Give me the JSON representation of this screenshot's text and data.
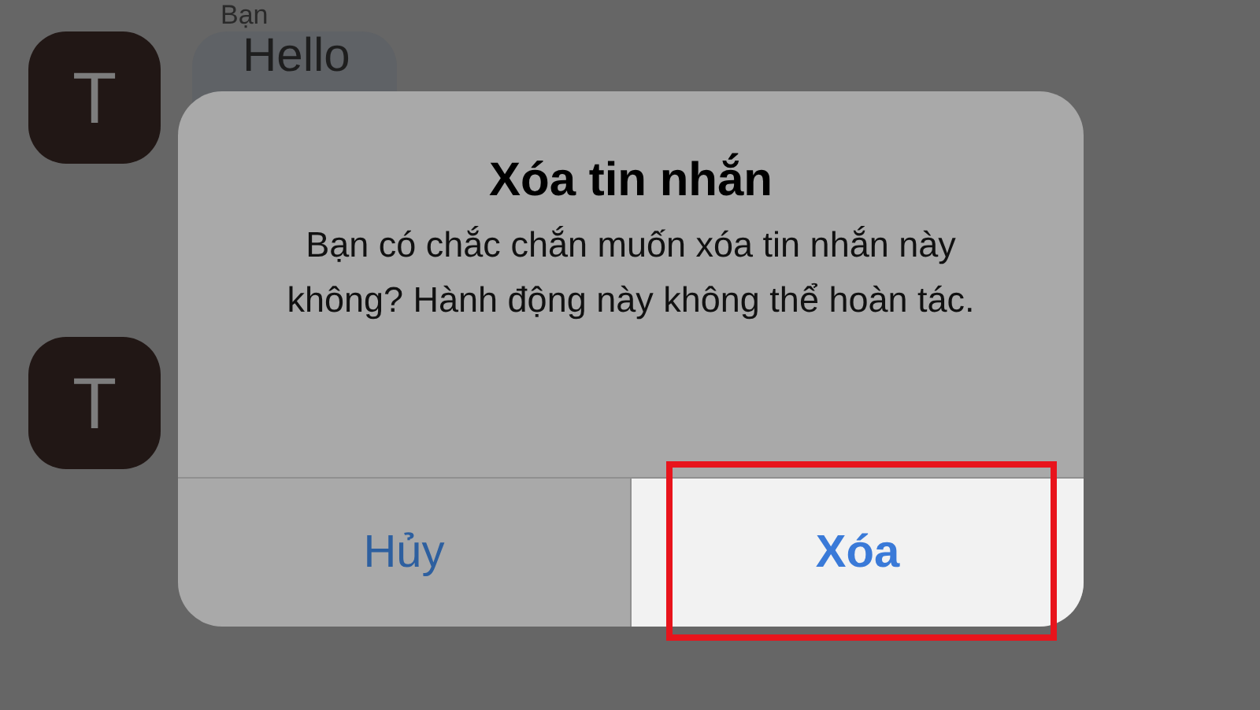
{
  "chat": {
    "sender_label": "Bạn",
    "messages": [
      {
        "avatar": "T",
        "text": "Hello"
      },
      {
        "avatar": "T"
      }
    ]
  },
  "dialog": {
    "title": "Xóa tin nhắn",
    "message": "Bạn có chắc chắn muốn xóa tin nhắn này không? Hành động này không thể hoàn tác.",
    "buttons": [
      {
        "label": "Hủy",
        "highlighted": false
      },
      {
        "label": "Xóa",
        "highlighted": true
      }
    ]
  }
}
